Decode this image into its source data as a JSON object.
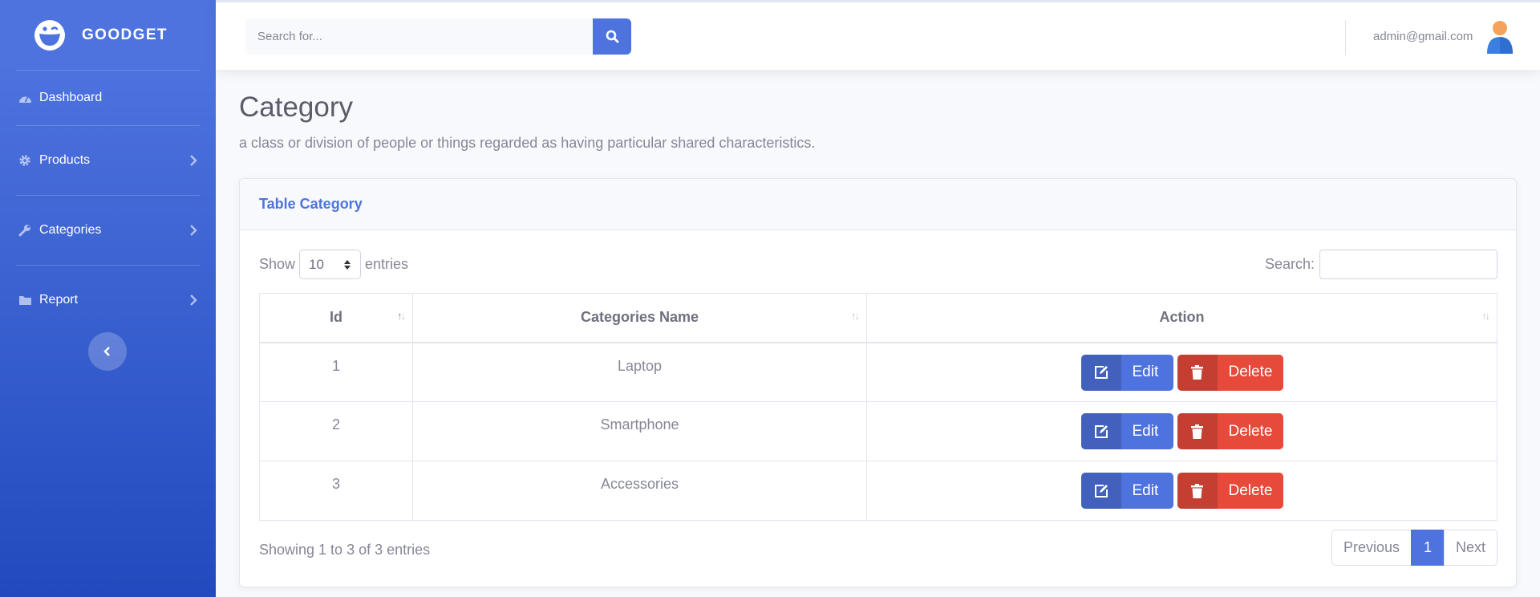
{
  "brand": {
    "name": "GOODGET"
  },
  "sidebar": {
    "items": [
      {
        "label": "Dashboard",
        "icon": "tachometer-icon"
      },
      {
        "label": "Products",
        "icon": "gear-icon"
      },
      {
        "label": "Categories",
        "icon": "wrench-icon"
      },
      {
        "label": "Report",
        "icon": "folder-icon"
      }
    ],
    "toggle_icon": "chevron-left-icon"
  },
  "topbar": {
    "search_placeholder": "Search for...",
    "search_icon": "search-icon",
    "user_email": "admin@gmail.com",
    "avatar_icon": "user-avatar-icon"
  },
  "page": {
    "title": "Category",
    "description": "a class or division of people or things regarded as having particular shared characteristics."
  },
  "card": {
    "title": "Table Category",
    "show_label": "Show",
    "entries_label": "entries",
    "page_length": "10",
    "search_label": "Search:",
    "search_value": "",
    "columns": [
      "Id",
      "Categories Name",
      "Action"
    ],
    "rows": [
      {
        "id": "1",
        "name": "Laptop"
      },
      {
        "id": "2",
        "name": "Smartphone"
      },
      {
        "id": "3",
        "name": "Accessories"
      }
    ],
    "edit_label": "Edit",
    "delete_label": "Delete",
    "info": "Showing 1 to 3 of 3 entries",
    "pagination": {
      "previous": "Previous",
      "current": "1",
      "next": "Next"
    }
  },
  "colors": {
    "primary": "#4e73df",
    "danger": "#e74a3b",
    "text": "#858796"
  }
}
